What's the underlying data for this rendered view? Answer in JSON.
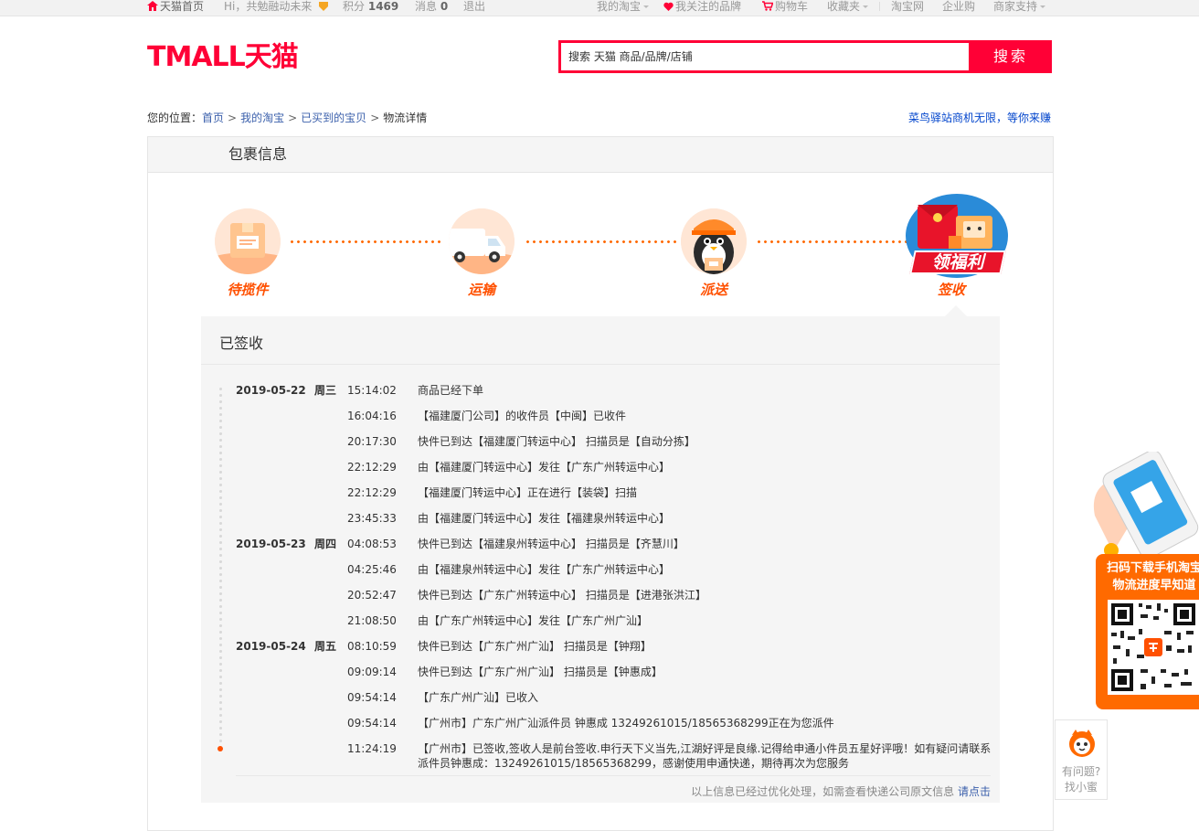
{
  "topbar": {
    "home": "天猫首页",
    "greeting": "Hi，共勉融动未来",
    "points_label": "积分",
    "points_value": "1469",
    "messages_label": "消息",
    "messages_value": "0",
    "logout": "退出",
    "my_taobao": "我的淘宝",
    "brands": "我关注的品牌",
    "cart": "购物车",
    "favorites": "收藏夹",
    "taobao": "淘宝网",
    "enterprise": "企业购",
    "merchant": "商家支持"
  },
  "header": {
    "logo_text": "TMALL天猫",
    "search_placeholder": "搜索 天猫 商品/品牌/店铺",
    "search_button": "搜索"
  },
  "breadcrumb": {
    "prefix": "您的位置：",
    "items": [
      "首页",
      "我的淘宝",
      "已买到的宝贝"
    ],
    "current": "物流详情",
    "sep": ">"
  },
  "ad_link": "菜鸟驿站商机无限，等你来赚",
  "panel": {
    "title": "包裹信息"
  },
  "steps": [
    "待揽件",
    "运输",
    "派送",
    "签收"
  ],
  "step_badge": "领福利",
  "tracking": {
    "status": "已签收",
    "rows": [
      {
        "date": "2019-05-22",
        "weekday": "周三",
        "time": "15:14:02",
        "desc": "商品已经下单"
      },
      {
        "date": "",
        "weekday": "",
        "time": "16:04:16",
        "desc": "【福建厦门公司】的收件员【中闽】已收件"
      },
      {
        "date": "",
        "weekday": "",
        "time": "20:17:30",
        "desc": "快件已到达【福建厦门转运中心】 扫描员是【自动分拣】"
      },
      {
        "date": "",
        "weekday": "",
        "time": "22:12:29",
        "desc": "由【福建厦门转运中心】发往【广东广州转运中心】"
      },
      {
        "date": "",
        "weekday": "",
        "time": "22:12:29",
        "desc": "【福建厦门转运中心】正在进行【装袋】扫描"
      },
      {
        "date": "",
        "weekday": "",
        "time": "23:45:33",
        "desc": "由【福建厦门转运中心】发往【福建泉州转运中心】"
      },
      {
        "date": "2019-05-23",
        "weekday": "周四",
        "time": "04:08:53",
        "desc": "快件已到达【福建泉州转运中心】 扫描员是【齐慧川】"
      },
      {
        "date": "",
        "weekday": "",
        "time": "04:25:46",
        "desc": "由【福建泉州转运中心】发往【广东广州转运中心】"
      },
      {
        "date": "",
        "weekday": "",
        "time": "20:52:47",
        "desc": "快件已到达【广东广州转运中心】 扫描员是【进港张洪江】"
      },
      {
        "date": "",
        "weekday": "",
        "time": "21:08:50",
        "desc": "由【广东广州转运中心】发往【广东广州广汕】"
      },
      {
        "date": "2019-05-24",
        "weekday": "周五",
        "time": "08:10:59",
        "desc": "快件已到达【广东广州广汕】 扫描员是【钟翔】"
      },
      {
        "date": "",
        "weekday": "",
        "time": "09:09:14",
        "desc": "快件已到达【广东广州广汕】 扫描员是【钟惠成】"
      },
      {
        "date": "",
        "weekday": "",
        "time": "09:54:14",
        "desc": "【广东广州广汕】已收入"
      },
      {
        "date": "",
        "weekday": "",
        "time": "09:54:14",
        "desc": "【广州市】广东广州广汕派件员 钟惠成 13249261015/18565368299正在为您派件"
      },
      {
        "date": "",
        "weekday": "",
        "time": "11:24:19",
        "desc": "【广州市】已签收,签收人是前台签收.申行天下义当先,江湖好评是良缘.记得给申通小件员五星好评哦！如有疑问请联系派件员钟惠成：13249261015/18565368299，感谢使用申通快递，期待再次为您服务"
      }
    ],
    "footer_text": "以上信息已经过优化处理，如需查看快递公司原文信息",
    "footer_link": "请点击"
  },
  "promo": {
    "line1": "扫码下载手机淘宝",
    "line2": "物流进度早知道"
  },
  "helper": {
    "line1": "有问题?",
    "line2": "找小蜜"
  },
  "colors": {
    "brand": "#ff0036",
    "accent": "#ff5000",
    "link": "#3a5fab"
  }
}
